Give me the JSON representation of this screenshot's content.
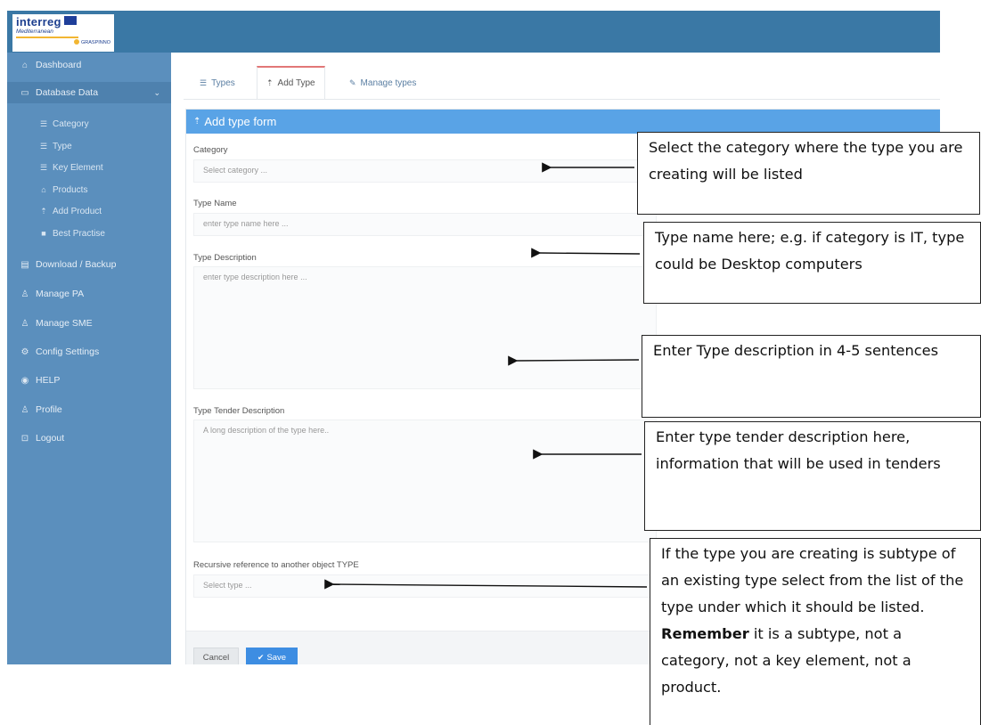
{
  "logo": {
    "brand": "interreg",
    "subtitle": "Mediterranean",
    "project": "GRASPINNO"
  },
  "sidebar": {
    "items": [
      {
        "icon": "home-icon",
        "label": "Dashboard"
      },
      {
        "icon": "folder-icon",
        "label": "Database Data"
      },
      {
        "icon": "list-icon",
        "label": "Category"
      },
      {
        "icon": "list-icon",
        "label": "Type"
      },
      {
        "icon": "list-icon",
        "label": "Key Element"
      },
      {
        "icon": "bag-icon",
        "label": "Products"
      },
      {
        "icon": "upload-icon",
        "label": "Add Product"
      },
      {
        "icon": "folder-icon",
        "label": "Best Practise"
      },
      {
        "icon": "database-icon",
        "label": "Download / Backup"
      },
      {
        "icon": "users-icon",
        "label": "Manage PA"
      },
      {
        "icon": "users-icon",
        "label": "Manage SME"
      },
      {
        "icon": "gear-icon",
        "label": "Config Settings"
      },
      {
        "icon": "help-icon",
        "label": "HELP"
      },
      {
        "icon": "user-icon",
        "label": "Profile"
      },
      {
        "icon": "lock-icon",
        "label": "Logout"
      }
    ]
  },
  "tabs": [
    {
      "icon": "list-icon",
      "label": "Types"
    },
    {
      "icon": "upload-icon",
      "label": "Add Type"
    },
    {
      "icon": "wrench-icon",
      "label": "Manage types"
    }
  ],
  "form": {
    "title": "Add type form",
    "category_label": "Category",
    "category_placeholder": "Select category ...",
    "name_label": "Type Name",
    "name_placeholder": "enter type name here ...",
    "description_label": "Type Description",
    "description_placeholder": "enter type description here ...",
    "tender_label": "Type Tender Description",
    "tender_placeholder": "A long description of the type here..",
    "recursive_label": "Recursive reference to another object TYPE",
    "recursive_placeholder": "Select type ...",
    "cancel_label": "Cancel",
    "save_label": "Save"
  },
  "callouts": {
    "category": "Select the category where the type you are creating will be listed",
    "name": "Type name here; e.g. if category is IT, type could be Desktop computers",
    "description": "Enter Type description in 4-5 sentences",
    "tender": "Enter type tender description here, information that will be used in tenders",
    "subtype_prefix": "If the type you are creating is subtype of an existing type select from the list of the type under which it should be listed.",
    "subtype_bold": "Remember",
    "subtype_suffix": "it is a subtype, not a category, not a key element, not a product."
  }
}
